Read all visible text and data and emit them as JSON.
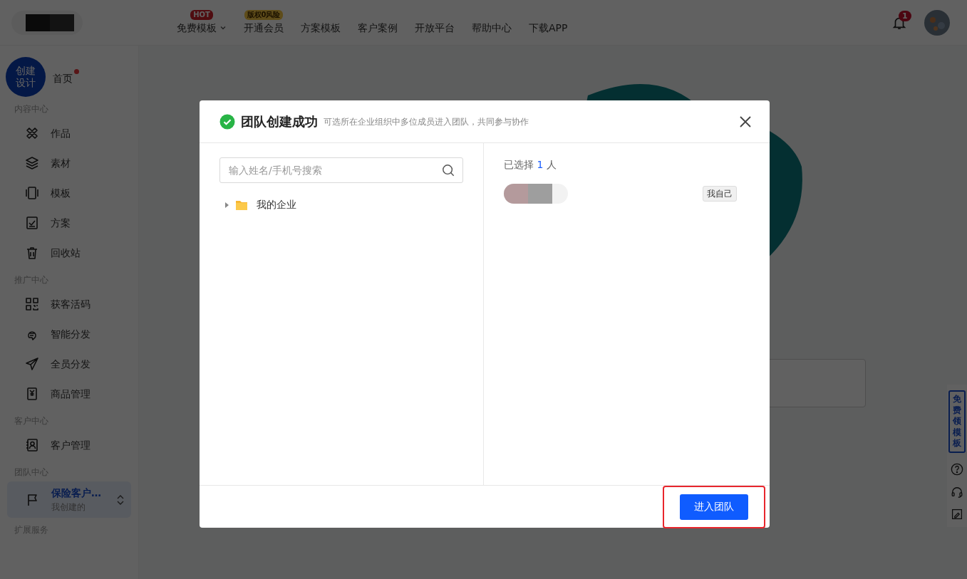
{
  "header": {
    "nav": [
      {
        "label": "免费模板",
        "badge": "HOT",
        "caret": true
      },
      {
        "label": "开通会员",
        "badge": "版权0风险",
        "caret": false
      },
      {
        "label": "方案模板",
        "caret": false
      },
      {
        "label": "客户案例",
        "caret": false
      },
      {
        "label": "开放平台",
        "caret": false
      },
      {
        "label": "帮助中心",
        "caret": false
      },
      {
        "label": "下载APP",
        "caret": false
      }
    ],
    "notification_count": "1"
  },
  "sidebar": {
    "create_button": "创建设计",
    "home": {
      "label": "首页",
      "dot": true
    },
    "sections": [
      {
        "title": "内容中心",
        "items": [
          {
            "label": "作品"
          },
          {
            "label": "素材"
          },
          {
            "label": "模板"
          },
          {
            "label": "方案"
          },
          {
            "label": "回收站"
          }
        ]
      },
      {
        "title": "推广中心",
        "items": [
          {
            "label": "获客活码"
          },
          {
            "label": "智能分发"
          },
          {
            "label": "全员分发"
          },
          {
            "label": "商品管理"
          }
        ]
      },
      {
        "title": "客户中心",
        "items": [
          {
            "label": "客户管理"
          }
        ]
      },
      {
        "title": "团队中心",
        "team": {
          "name": "保险客户…",
          "sub": "我创建的",
          "selected": true
        }
      },
      {
        "title": "扩展服务"
      }
    ]
  },
  "float_bar": {
    "promo": "免费领模板"
  },
  "dialog": {
    "title": "团队创建成功",
    "subtitle": "可选所在企业组织中多位成员进入团队，共同参与协作",
    "search": {
      "placeholder": "输入姓名/手机号搜索"
    },
    "tree": [
      {
        "label": "我的企业",
        "expanded": false
      }
    ],
    "selected_prefix": "已选择",
    "selected_count": "1",
    "selected_unit": "人",
    "members": [
      {
        "tag": "我自己"
      }
    ],
    "confirm": "进入团队",
    "confirm_highlighted": true
  }
}
